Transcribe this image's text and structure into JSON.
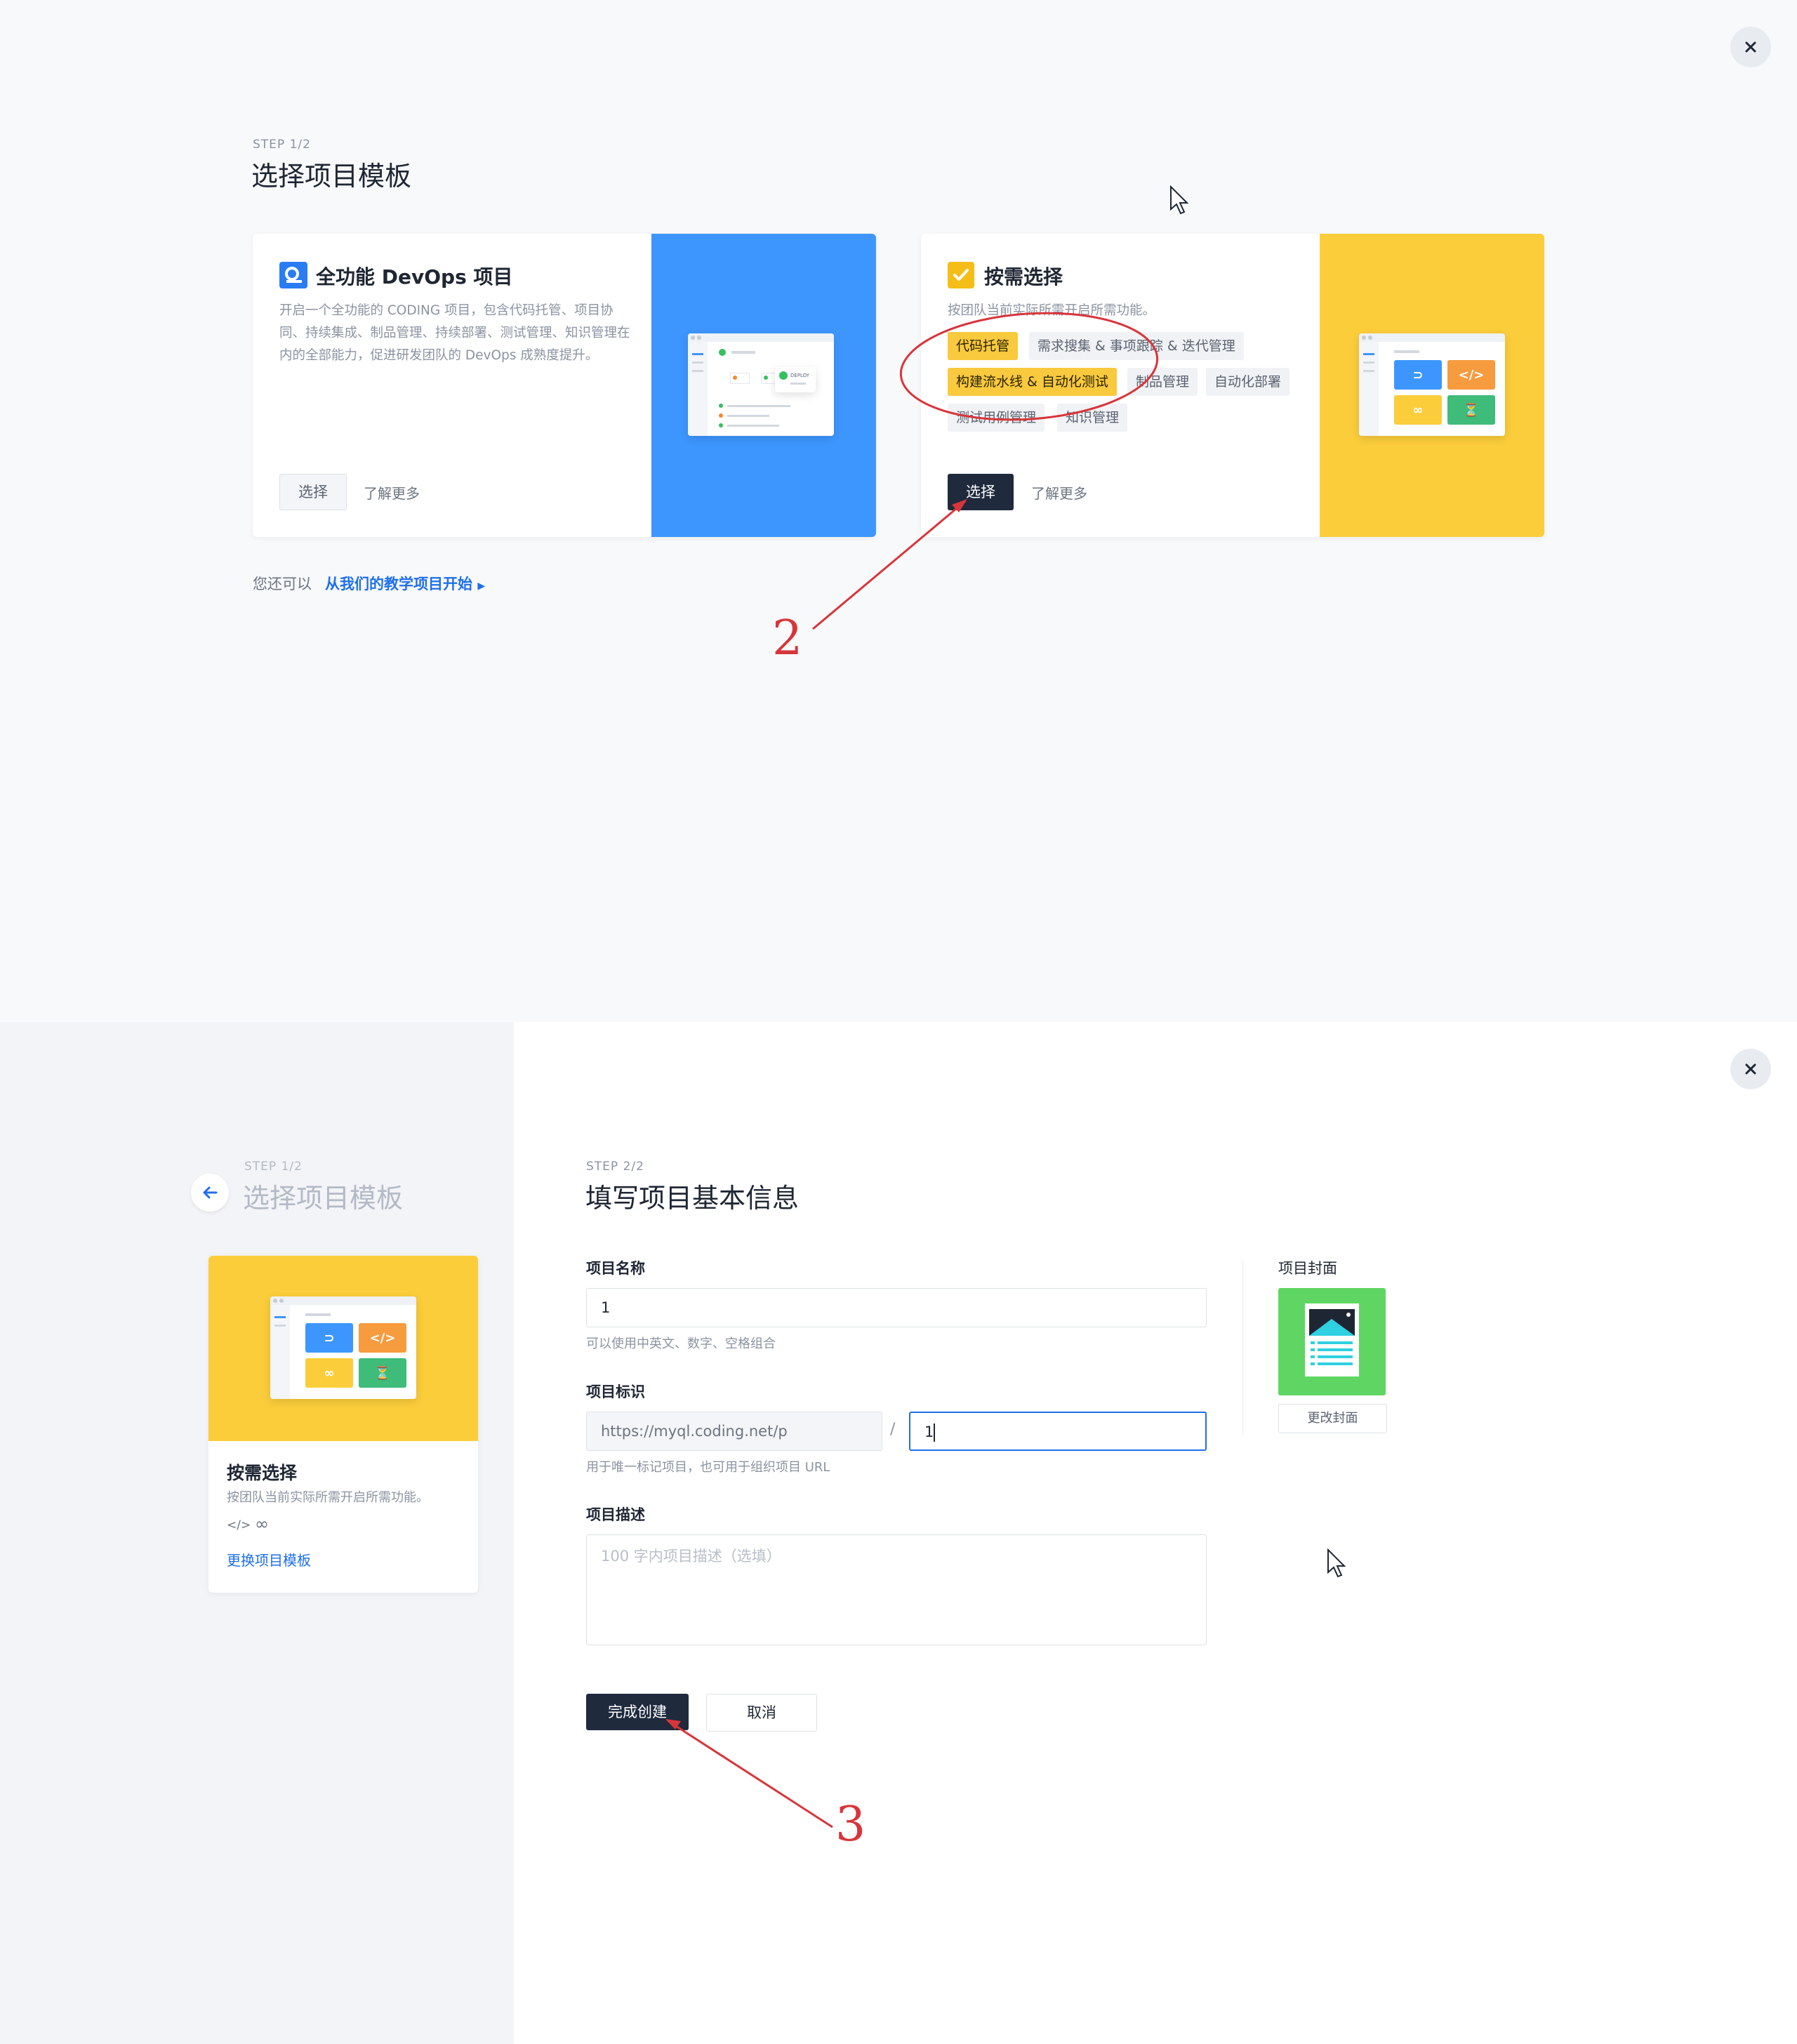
{
  "top": {
    "step": "STEP 1/2",
    "title": "选择项目模板",
    "card_devops": {
      "title": "全功能 DevOps 项目",
      "desc": "开启一个全功能的 CODING 项目，包含代码托管、项目协同、持续集成、制品管理、持续部署、测试管理、知识管理在内的全部能力，促进研发团队的 DevOps 成熟度提升。",
      "select": "选择",
      "more": "了解更多",
      "deploy": "DEPLOY",
      "color": "#3d96fd"
    },
    "card_custom": {
      "title": "按需选择",
      "desc": "按团队当前实际所需开启所需功能。",
      "tags": [
        "代码托管",
        "需求搜集 & 事项跟踪 & 迭代管理",
        "构建流水线 & 自动化测试",
        "制品管理",
        "自动化部署",
        "测试用例管理",
        "知识管理"
      ],
      "select": "选择",
      "more": "了解更多",
      "color": "#fbcd3b"
    },
    "tutorial_prefix": "您还可以",
    "tutorial_link": "从我们的教学项目开始"
  },
  "annotations": {
    "step2": "2",
    "step3": "3",
    "color": "#d8353a"
  },
  "bottom": {
    "left": {
      "step": "STEP 1/2",
      "title": "选择项目模板",
      "card_title": "按需选择",
      "card_desc": "按团队当前实际所需开启所需功能。",
      "change_link": "更换项目模板"
    },
    "form": {
      "step": "STEP 2/2",
      "title": "填写项目基本信息",
      "name_label": "项目名称",
      "name_value": "1",
      "name_hint": "可以使用中英文、数字、空格组合",
      "id_label": "项目标识",
      "id_prefix": "https://myql.coding.net/p",
      "id_sep": "/",
      "id_value": "1",
      "id_hint": "用于唯一标记项目，也可用于组织项目 URL",
      "desc_label": "项目描述",
      "desc_placeholder": "100 字内项目描述（选填）",
      "submit": "完成创建",
      "cancel": "取消",
      "cover_label": "项目封面",
      "cover_change": "更改封面",
      "cover_color": "#5fd663"
    }
  }
}
